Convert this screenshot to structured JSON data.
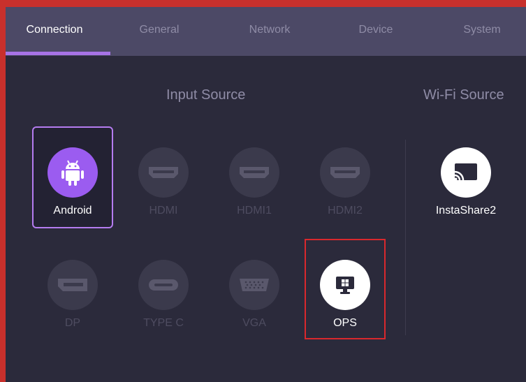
{
  "tabs": [
    {
      "label": "Connection",
      "active": true
    },
    {
      "label": "General",
      "active": false
    },
    {
      "label": "Network",
      "active": false
    },
    {
      "label": "Device",
      "active": false
    },
    {
      "label": "System",
      "active": false
    }
  ],
  "input_source": {
    "title": "Input Source",
    "items": [
      {
        "label": "Android",
        "icon": "android-icon",
        "state": "selected"
      },
      {
        "label": "HDMI",
        "icon": "hdmi-port-icon",
        "state": "disabled"
      },
      {
        "label": "HDMI1",
        "icon": "hdmi-port-icon",
        "state": "disabled"
      },
      {
        "label": "HDMI2",
        "icon": "hdmi-port-icon",
        "state": "disabled"
      },
      {
        "label": "DP",
        "icon": "displayport-icon",
        "state": "disabled"
      },
      {
        "label": "TYPE C",
        "icon": "usb-c-port-icon",
        "state": "disabled"
      },
      {
        "label": "VGA",
        "icon": "vga-port-icon",
        "state": "disabled"
      },
      {
        "label": "OPS",
        "icon": "windows-monitor-icon",
        "state": "available"
      }
    ]
  },
  "wifi_source": {
    "title": "Wi-Fi Source",
    "items": [
      {
        "label": "InstaShare2",
        "icon": "cast-icon",
        "state": "available"
      }
    ]
  },
  "colors": {
    "accent": "#a773e6",
    "android_icon_bg": "#9b5cf0",
    "highlight": "#d9282d",
    "background": "#2b2a3b",
    "tab_bar": "#4c4966"
  }
}
